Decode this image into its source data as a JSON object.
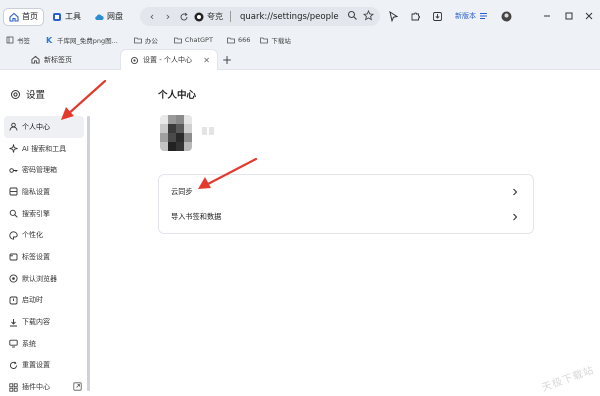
{
  "toolbar": {
    "home_label": "首页",
    "tools_label": "工具",
    "netdisk_label": "网盘",
    "brand_label": "夸克",
    "url": "quark://settings/people",
    "new_version_label": "新版本"
  },
  "bookmarks": [
    {
      "label": "书签",
      "icon": "bookmark-icon"
    },
    {
      "label": "千库网_免费png图...",
      "icon": "site-k-icon"
    },
    {
      "label": "办公",
      "icon": "folder-icon"
    },
    {
      "label": "ChatGPT",
      "icon": "folder-icon"
    },
    {
      "label": "666",
      "icon": "folder-icon"
    },
    {
      "label": "下载站",
      "icon": "folder-icon"
    }
  ],
  "tabs": [
    {
      "label": "新标签页",
      "icon": "home-icon",
      "active": false
    },
    {
      "label": "设置 - 个人中心",
      "icon": "gear-icon",
      "active": true
    }
  ],
  "sidebar": {
    "title": "设置",
    "items": [
      {
        "label": "个人中心",
        "icon": "user-icon",
        "active": true
      },
      {
        "label": "AI 搜索和工具",
        "icon": "sparkle-icon",
        "active": false
      },
      {
        "label": "密码管理箱",
        "icon": "key-icon",
        "active": false
      },
      {
        "label": "隐私设置",
        "icon": "privacy-icon",
        "active": false
      },
      {
        "label": "搜索引擎",
        "icon": "search-icon",
        "active": false
      },
      {
        "label": "个性化",
        "icon": "palette-icon",
        "active": false
      },
      {
        "label": "标签设置",
        "icon": "tab-settings-icon",
        "active": false
      },
      {
        "label": "默认浏览器",
        "icon": "browser-icon",
        "active": false
      },
      {
        "label": "启动时",
        "icon": "power-icon",
        "active": false
      },
      {
        "label": "下载内容",
        "icon": "download-icon",
        "active": false
      },
      {
        "label": "系统",
        "icon": "monitor-icon",
        "active": false
      },
      {
        "label": "重置设置",
        "icon": "reset-icon",
        "active": false
      },
      {
        "label": "插件中心",
        "icon": "grid-icon",
        "active": false
      }
    ]
  },
  "main": {
    "title": "个人中心",
    "options": [
      {
        "label": "云同步"
      },
      {
        "label": "导入书签和数据"
      }
    ]
  },
  "watermark": "天极下载站",
  "colors": {
    "chrome_bg": "#eef1f6",
    "annotation_arrow": "#e23b2e",
    "accent": "#2d5fd3"
  }
}
